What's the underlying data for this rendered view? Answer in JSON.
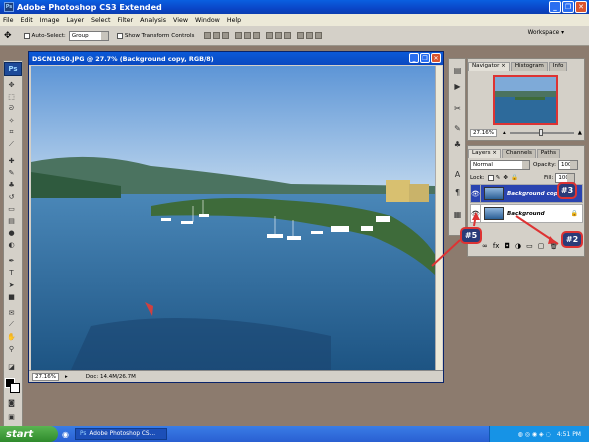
{
  "app": {
    "title": "Adobe Photoshop CS3 Extended",
    "logo": "Ps"
  },
  "window_buttons": {
    "minimize": "_",
    "restore": "❐",
    "close": "✕"
  },
  "menu": [
    "File",
    "Edit",
    "Image",
    "Layer",
    "Select",
    "Filter",
    "Analysis",
    "View",
    "Window",
    "Help"
  ],
  "options": {
    "auto_select_label": "Auto-Select:",
    "auto_select_value": "Group",
    "show_transform_label": "Show Transform Controls",
    "workspace_label": "Workspace ▾"
  },
  "document": {
    "title": "DSCN1050.JPG @ 27.7% (Background copy, RGB/8)",
    "zoom": "27.16%",
    "doc_info": "Doc: 14.4M/26.7M"
  },
  "navigator": {
    "tabs": [
      "Navigator ×",
      "Histogram",
      "Info"
    ],
    "zoom": "27.16%"
  },
  "layers_panel": {
    "tabs": [
      "Layers ×",
      "Channels",
      "Paths"
    ],
    "blend_mode": "Normal",
    "opacity_label": "Opacity:",
    "opacity_value": "100%",
    "lock_label": "Lock:",
    "fill_label": "Fill:",
    "fill_value": "100%",
    "layers": [
      {
        "name": "Background copy",
        "selected": true
      },
      {
        "name": "Background",
        "locked": true
      }
    ]
  },
  "annotations": {
    "n3": "#3",
    "n5": "#5",
    "n2": "#2"
  },
  "taskbar": {
    "start": "start",
    "task": "Adobe Photoshop CS...",
    "clock": "4:51 PM"
  },
  "colors": {
    "accent_red": "#d33",
    "selected_layer": "#2a44b0"
  }
}
